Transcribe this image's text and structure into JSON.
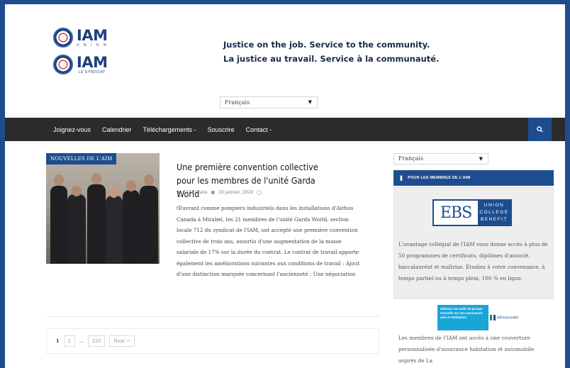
{
  "header": {
    "logo_en": {
      "word": "IAM",
      "sub": "U N I O N"
    },
    "logo_fr": {
      "word": "IAM",
      "sub": "LE SYNDICAT"
    },
    "tagline_en": "Justice on the job. Service to the community.",
    "tagline_fr": "La justice au travail. Service à la communauté.",
    "language_select": "Français"
  },
  "nav": {
    "items": [
      "Joignez-vous",
      "Calendrier",
      "Téléchargements -",
      "Souscrire",
      "Contact -"
    ],
    "search_icon": "search-icon"
  },
  "post": {
    "category": "NOUVELLES DE L'AIM",
    "title": "Une première convention collective pour les membres de l'unité Garda World",
    "author": "IAM Union",
    "date": "26 janvier, 2026",
    "excerpt": "Œuvrant comme pompiers industriels dans les installations d'Airbus Canada à Mirabel, les 21 membres de l'unité Garda World, section locale 712 du syndicat de l'IAM, ont accepté une première convention collective de trois ans, assortis d'une augmentation de la masse salariale de 17% sur la durée du contrat. Le contrat de travail apporte également les améliorations suivantes aux conditions de travail : Ajout d'une distinction marquée concernant l'ancienneté : Une négociation"
  },
  "pagination": {
    "current": "1",
    "page2": "2",
    "ellipsis": "...",
    "last": "233",
    "next": "Next →"
  },
  "sidebar": {
    "language_select": "Français",
    "widget_title": "POUR LES MEMBRES DE L'AIM",
    "ebs": {
      "left": "EBS",
      "line1": "UNION",
      "line2": "COLLEGE",
      "line3": "BENEFIT"
    },
    "ebs_text": "L'avantage collégial de l'IAM vous donne accès à plus de 50 programmes de certificats, diplômes d'associé, baccalauréat et maîtrise. Étudiez à votre convenance, à temps partiel ou à temps plein, 100 % en ligne.",
    "insurance_banner": "Obtenez vos tarifs de groupe exclusifs sur vos assurances auto et habitation!",
    "insurance_logo": "laPersonnelle",
    "insurance_text": "Les membres de l'IAM ont accès à une couverture personnalisée d'assurance habitation et automobile auprès de La"
  },
  "colors": {
    "brand_blue": "#1d4d8f",
    "nav_dark": "#2b2b2b",
    "banner_cyan": "#1aa5d8"
  }
}
